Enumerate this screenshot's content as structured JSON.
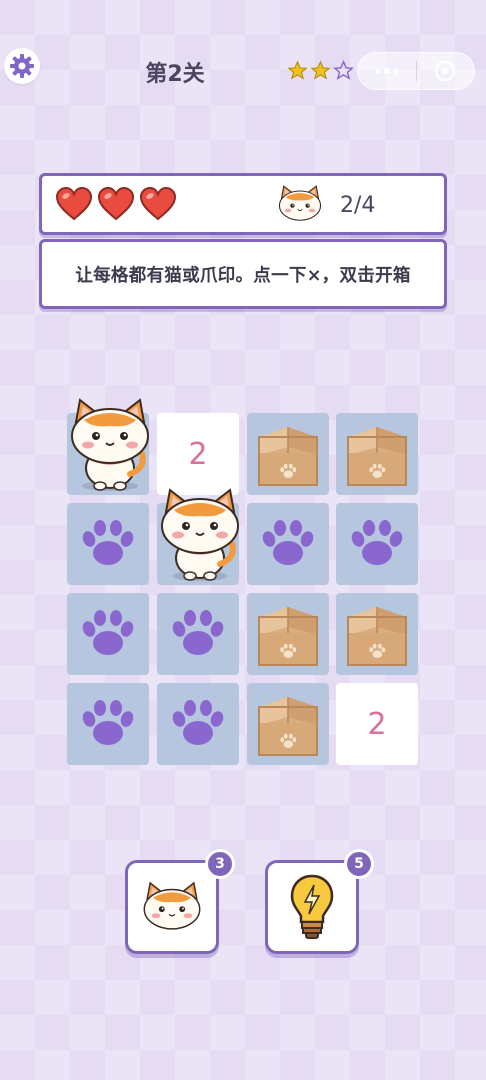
{
  "header": {
    "level_title": "第2关",
    "stars_filled": 2,
    "stars_total": 3,
    "settings_icon": "gear-icon",
    "capsule_icons": [
      "more-dots-icon",
      "close-circle-icon"
    ]
  },
  "status": {
    "lives": 3,
    "cat_count": "2/4"
  },
  "instruction": "让每格都有猫或爪印。点一下×，双击开箱",
  "board": {
    "rows": [
      [
        "cat",
        "2",
        "box",
        "box"
      ],
      [
        "paw",
        "cat",
        "paw",
        "paw"
      ],
      [
        "paw",
        "paw",
        "box",
        "box"
      ],
      [
        "paw",
        "paw",
        "box",
        "2"
      ]
    ]
  },
  "tools": {
    "cat_hint_count": "3",
    "bulb_hint_count": "5"
  },
  "colors": {
    "accent": "#7f66b9",
    "paw": "#8a67cf",
    "cell": "#b6c6de",
    "number": "#d9709a",
    "heart": "#e94b3f",
    "star": "#f2c21a"
  }
}
